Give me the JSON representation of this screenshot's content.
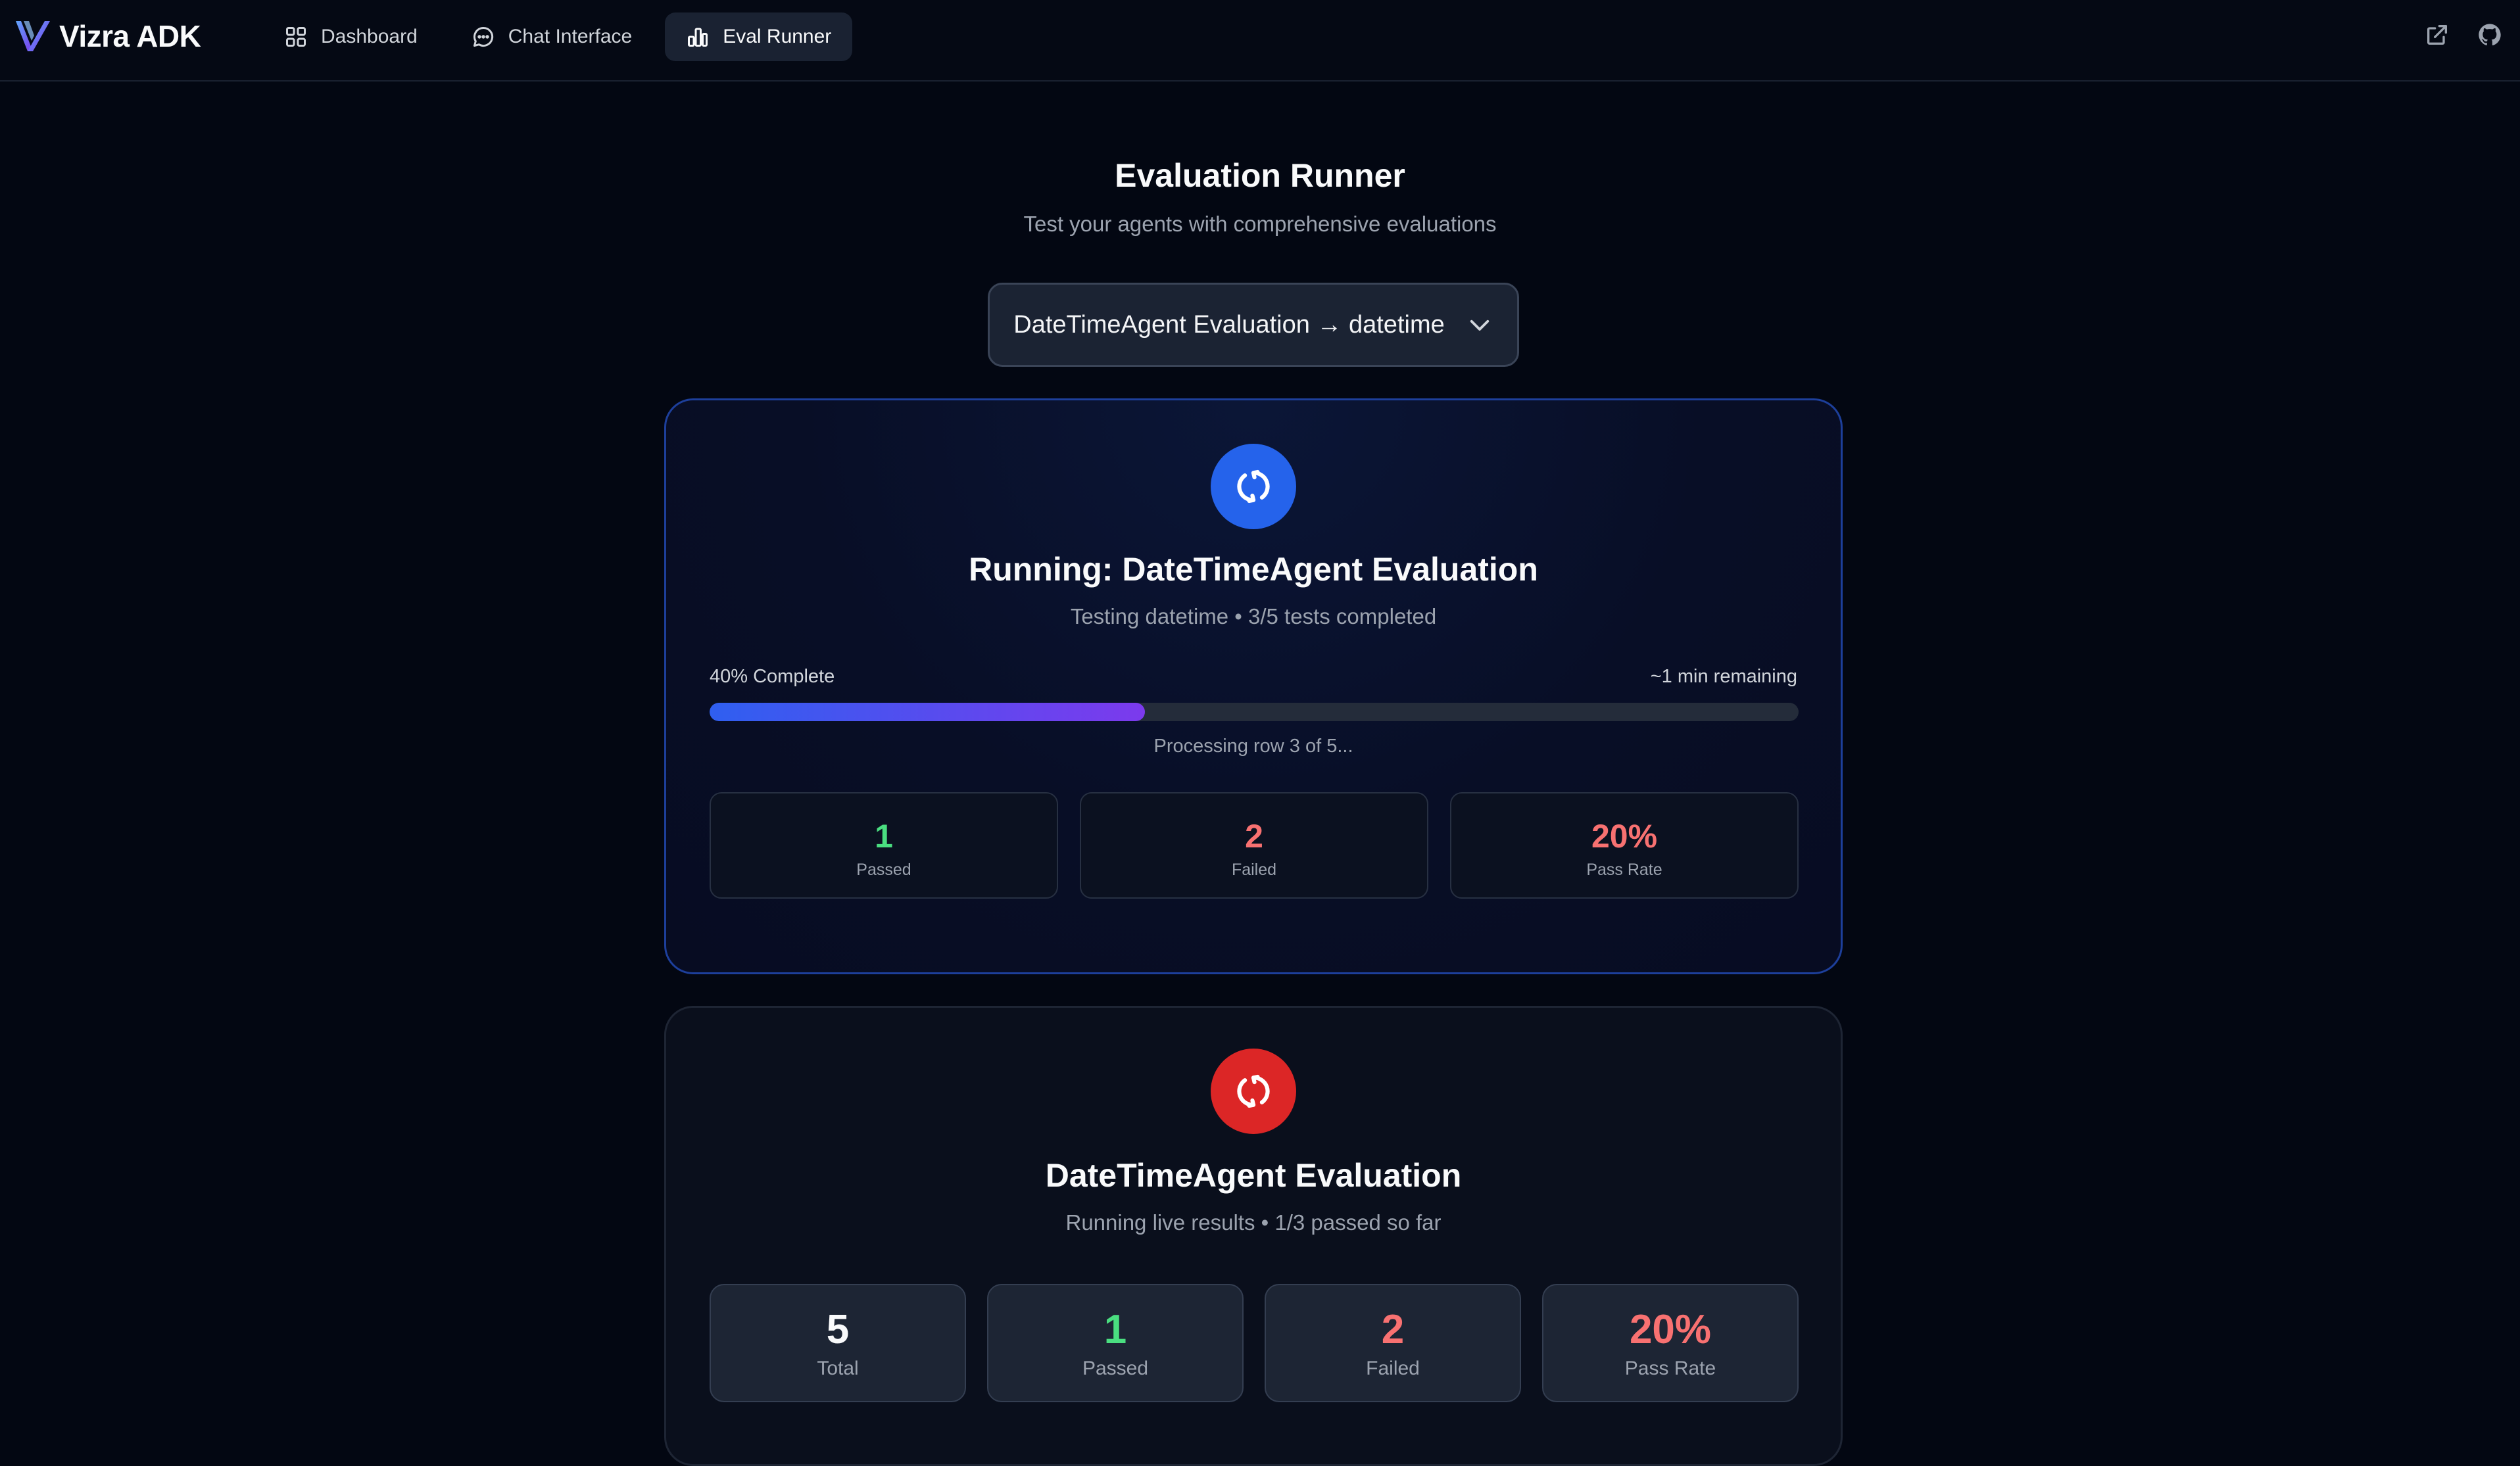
{
  "brand": {
    "name": "Vizra ADK",
    "accent": "#3b82f6"
  },
  "nav": {
    "items": [
      {
        "label": "Dashboard",
        "icon": "grid-icon"
      },
      {
        "label": "Chat Interface",
        "icon": "chat-bubble-icon"
      },
      {
        "label": "Eval Runner",
        "icon": "bar-chart-icon",
        "active": true
      }
    ],
    "actions": [
      "external-link-icon",
      "github-icon"
    ]
  },
  "header": {
    "title": "Evaluation Runner",
    "subtitle": "Test your agents with comprehensive evaluations"
  },
  "selector": {
    "value": "DateTimeAgent Evaluation → datetime"
  },
  "running": {
    "icon": "refresh-icon",
    "title": "Running: DateTimeAgent Evaluation",
    "subtitle": "Testing datetime • 3/5 tests completed",
    "progress_label": "40% Complete",
    "progress_value": 0.4,
    "remaining": "~1 min remaining",
    "note": "Processing row 3 of 5...",
    "stats": [
      {
        "value": "1",
        "label": "Passed",
        "color": "#4ade80"
      },
      {
        "value": "2",
        "label": "Failed",
        "color": "#f87171"
      },
      {
        "value": "20%",
        "label": "Pass Rate",
        "color": "#f87171"
      }
    ]
  },
  "results": {
    "icon": "refresh-icon",
    "title": "DateTimeAgent Evaluation",
    "subtitle": "Running live results • 1/3 passed so far",
    "stats": [
      {
        "value": "5",
        "label": "Total",
        "color": "#f9fafb"
      },
      {
        "value": "1",
        "label": "Passed",
        "color": "#4ade80"
      },
      {
        "value": "2",
        "label": "Failed",
        "color": "#f87171"
      },
      {
        "value": "20%",
        "label": "Pass Rate",
        "color": "#f87171"
      }
    ]
  }
}
